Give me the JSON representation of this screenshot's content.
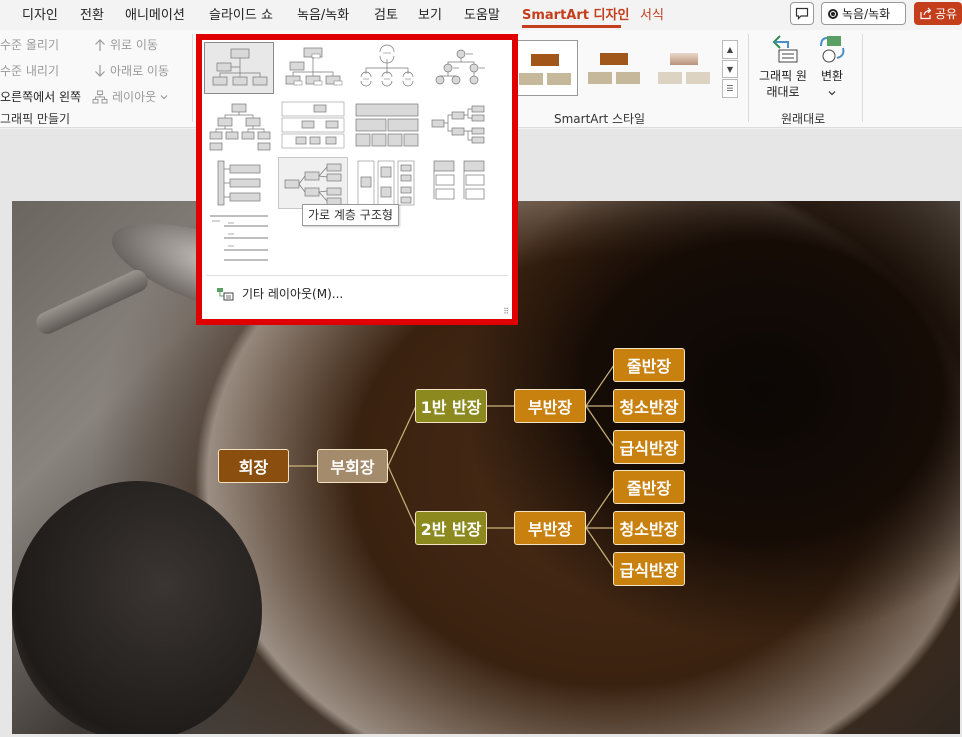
{
  "tabs": [
    {
      "label": "디자인"
    },
    {
      "label": "전환"
    },
    {
      "label": "애니메이션"
    },
    {
      "label": "슬라이드 쇼"
    },
    {
      "label": "녹음/녹화"
    },
    {
      "label": "검토"
    },
    {
      "label": "보기"
    },
    {
      "label": "도움말"
    },
    {
      "label": "SmartArt 디자인"
    },
    {
      "label": "서식"
    }
  ],
  "header_buttons": {
    "record_label": "녹음/녹화",
    "share_label": "공유"
  },
  "ribbon": {
    "create_graphic": {
      "promote": "수준 올리기",
      "demote": "수준 내리기",
      "right_to_left": "오른쪽에서 왼쪽",
      "move_up": "위로 이동",
      "move_down": "아래로 이동",
      "layout": "레이아웃",
      "group_label": "그래픽 만들기"
    },
    "smartart_styles_label": "SmartArt 스타일",
    "reset": {
      "reset_graphic": "그래픽 원래대로",
      "convert": "변환",
      "group_label": "원래대로"
    }
  },
  "layout_dropdown": {
    "tooltip": "가로 계층 구조형",
    "more_layouts": "기타 레이아웃(M)..."
  },
  "slide": {
    "org_chart": {
      "chairman": "회장",
      "vice_chairman": "부회장",
      "class1": "1반 반장",
      "class2": "2반 반장",
      "vice_leader": "부반장",
      "line_leader": "줄반장",
      "cleaning_leader": "청소반장",
      "meal_leader": "급식반장"
    }
  },
  "colors": {
    "accent": "#c43e1c",
    "highlight_border": "#e00000",
    "chairman_fill": "#8a4f0f",
    "vice_chairman_fill": "#a38b6b",
    "class_fill": "#8c8a1f",
    "leader_fill": "#c8800e"
  }
}
